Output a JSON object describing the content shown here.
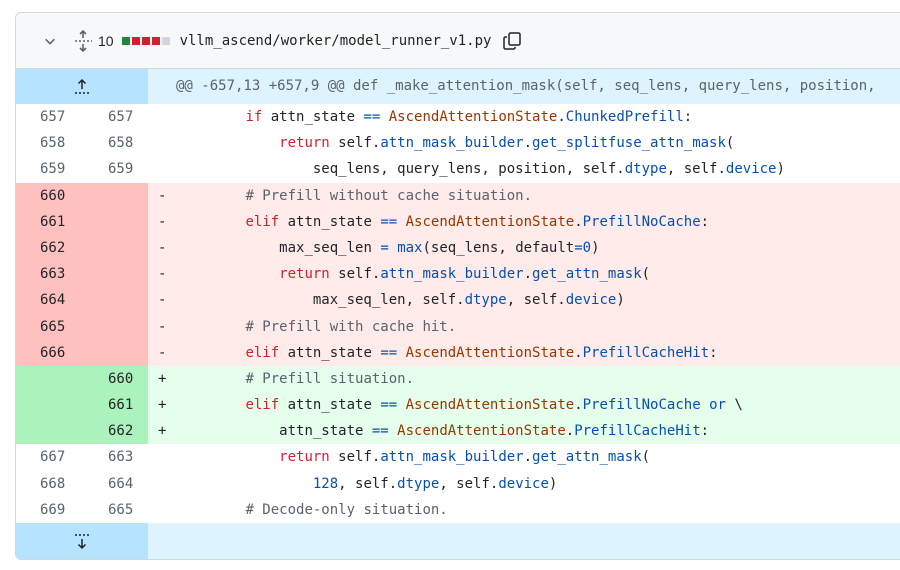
{
  "header": {
    "changes_count": "10",
    "file_path": "vllm_ascend/worker/model_runner_v1.py",
    "change_blocks": [
      "#1f883d",
      "#cf222e",
      "#cf222e",
      "#cf222e",
      "#d0d7de"
    ]
  },
  "hunk": {
    "text": "@@ -657,13 +657,9 @@ def _make_attention_mask(self, seq_lens, query_lens, position,"
  },
  "rows": [
    {
      "type": "ctx",
      "old": "657",
      "new": "657",
      "sign": ""
    },
    {
      "type": "ctx",
      "old": "658",
      "new": "658",
      "sign": ""
    },
    {
      "type": "ctx",
      "old": "659",
      "new": "659",
      "sign": ""
    },
    {
      "type": "del",
      "old": "660",
      "new": "",
      "sign": "-"
    },
    {
      "type": "del",
      "old": "661",
      "new": "",
      "sign": "-"
    },
    {
      "type": "del",
      "old": "662",
      "new": "",
      "sign": "-"
    },
    {
      "type": "del",
      "old": "663",
      "new": "",
      "sign": "-"
    },
    {
      "type": "del",
      "old": "664",
      "new": "",
      "sign": "-"
    },
    {
      "type": "del",
      "old": "665",
      "new": "",
      "sign": "-"
    },
    {
      "type": "del",
      "old": "666",
      "new": "",
      "sign": "-"
    },
    {
      "type": "add",
      "old": "",
      "new": "660",
      "sign": "+"
    },
    {
      "type": "add",
      "old": "",
      "new": "661",
      "sign": "+"
    },
    {
      "type": "add",
      "old": "",
      "new": "662",
      "sign": "+"
    },
    {
      "type": "ctx",
      "old": "667",
      "new": "663",
      "sign": ""
    },
    {
      "type": "ctx",
      "old": "668",
      "new": "664",
      "sign": ""
    },
    {
      "type": "ctx",
      "old": "669",
      "new": "665",
      "sign": ""
    }
  ],
  "code": {
    "l0": {
      "indent": "        ",
      "t1": "if",
      "t2": " attn_state ",
      "t3": "==",
      "t4": " ",
      "t5": "AscendAttentionState",
      "t6": ".",
      "t7": "ChunkedPrefill",
      "t8": ":"
    },
    "l1": {
      "indent": "            ",
      "t1": "return",
      "t2": " self.",
      "t3": "attn_mask_builder",
      "t4": ".",
      "t5": "get_splitfuse_attn_mask",
      "t6": "("
    },
    "l2": {
      "indent": "                ",
      "t1": "seq_lens, query_lens, position, self.",
      "t2": "dtype",
      "t3": ", self.",
      "t4": "device",
      "t5": ")"
    },
    "l3": {
      "indent": "        ",
      "t1": "# Prefill without cache situation."
    },
    "l4": {
      "indent": "        ",
      "t1": "elif",
      "t2": " attn_state ",
      "t3": "==",
      "t4": " ",
      "t5": "AscendAttentionState",
      "t6": ".",
      "t7": "PrefillNoCache",
      "t8": ":"
    },
    "l5": {
      "indent": "            ",
      "t1": "max_seq_len ",
      "t2": "=",
      "t3": " ",
      "t4": "max",
      "t5": "(seq_lens, default",
      "t6": "=",
      "t7": "0",
      "t8": ")"
    },
    "l6": {
      "indent": "            ",
      "t1": "return",
      "t2": " self.",
      "t3": "attn_mask_builder",
      "t4": ".",
      "t5": "get_attn_mask",
      "t6": "("
    },
    "l7": {
      "indent": "                ",
      "t1": "max_seq_len, self.",
      "t2": "dtype",
      "t3": ", self.",
      "t4": "device",
      "t5": ")"
    },
    "l8": {
      "indent": "        ",
      "t1": "# Prefill with cache hit."
    },
    "l9": {
      "indent": "        ",
      "t1": "elif",
      "t2": " attn_state ",
      "t3": "==",
      "t4": " ",
      "t5": "AscendAttentionState",
      "t6": ".",
      "t7": "PrefillCacheHit",
      "t8": ":"
    },
    "l10": {
      "indent": "        ",
      "t1": "# Prefill situation."
    },
    "l11": {
      "indent": "        ",
      "t1": "elif",
      "t2": " attn_state ",
      "t3": "==",
      "t4": " ",
      "t5": "AscendAttentionState",
      "t6": ".",
      "t7": "PrefillNoCache",
      "t8": " ",
      "t9": "or",
      "t10": " \\"
    },
    "l12": {
      "indent": "            ",
      "t1": "attn_state ",
      "t2": "==",
      "t3": " ",
      "t4": "AscendAttentionState",
      "t5": ".",
      "t6": "PrefillCacheHit",
      "t7": ":"
    },
    "l13": {
      "indent": "            ",
      "t1": "return",
      "t2": " self.",
      "t3": "attn_mask_builder",
      "t4": ".",
      "t5": "get_attn_mask",
      "t6": "("
    },
    "l14": {
      "indent": "                ",
      "t1": "128",
      "t2": ", self.",
      "t3": "dtype",
      "t4": ", self.",
      "t5": "device",
      "t6": ")"
    },
    "l15": {
      "indent": "        ",
      "t1": "# Decode-only situation."
    }
  },
  "icons": {
    "collapse": "chevron-down-icon",
    "unfold": "unfold-icon",
    "copy": "copy-icon",
    "expand_up": "expand-up-icon",
    "expand_down": "expand-down-icon"
  }
}
